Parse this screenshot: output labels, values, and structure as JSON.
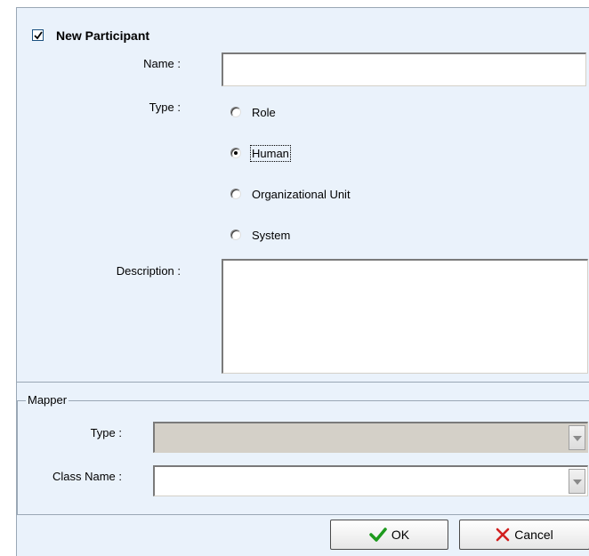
{
  "participant": {
    "header": {
      "checked": true,
      "label": "New Participant"
    },
    "name_label": "Name :",
    "name_value": "",
    "type_label": "Type :",
    "type_options": [
      "Role",
      "Human",
      "Organizational Unit",
      "System"
    ],
    "type_selected": "Human",
    "description_label": "Description :",
    "description_value": ""
  },
  "mapper": {
    "legend": "Mapper",
    "type_label": "Type :",
    "type_value": "",
    "class_name_label": "Class Name :",
    "class_name_value": ""
  },
  "buttons": {
    "ok_label": "OK",
    "cancel_label": "Cancel"
  },
  "colors": {
    "panel_bg": "#eaf2fb",
    "ok_check": "#1d9a1d",
    "cancel_x": "#d21f1f",
    "disabled_bg": "#d4d0c8"
  },
  "icons": {
    "ok": "checkmark-icon",
    "cancel": "x-icon",
    "dropdown": "chevron-down-icon"
  }
}
